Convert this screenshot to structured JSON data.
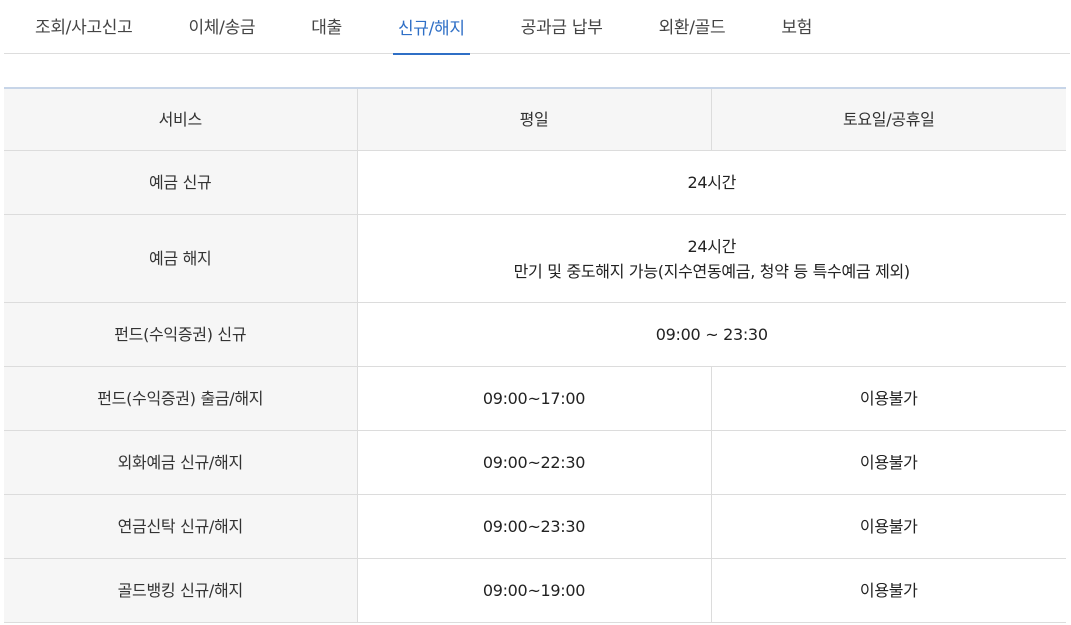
{
  "tabs": [
    {
      "label": "조회/사고신고",
      "active": false
    },
    {
      "label": "이체/송금",
      "active": false
    },
    {
      "label": "대출",
      "active": false
    },
    {
      "label": "신규/해지",
      "active": true
    },
    {
      "label": "공과금 납부",
      "active": false
    },
    {
      "label": "외환/골드",
      "active": false
    },
    {
      "label": "보험",
      "active": false
    }
  ],
  "table": {
    "headers": {
      "service": "서비스",
      "weekday": "평일",
      "weekend": "토요일/공휴일"
    },
    "rows": [
      {
        "service": "예금 신규",
        "both": "24시간"
      },
      {
        "service": "예금 해지",
        "both_line1": "24시간",
        "both_line2": "만기 및 중도해지 가능(지수연동예금, 청약 등 특수예금 제외)"
      },
      {
        "service": "펀드(수익증권) 신규",
        "both": "09:00 ~ 23:30"
      },
      {
        "service": "펀드(수익증권) 출금/해지",
        "weekday": "09:00~17:00",
        "weekend": "이용불가"
      },
      {
        "service": "외화예금 신규/해지",
        "weekday": "09:00~22:30",
        "weekend": "이용불가"
      },
      {
        "service": "연금신탁 신규/해지",
        "weekday": "09:00~23:30",
        "weekend": "이용불가"
      },
      {
        "service": "골드뱅킹 신규/해지",
        "weekday": "09:00~19:00",
        "weekend": "이용불가"
      }
    ]
  },
  "colors": {
    "accent": "#2f6fc6",
    "header_bg": "#f6f6f6",
    "border": "#dcdcdc"
  }
}
